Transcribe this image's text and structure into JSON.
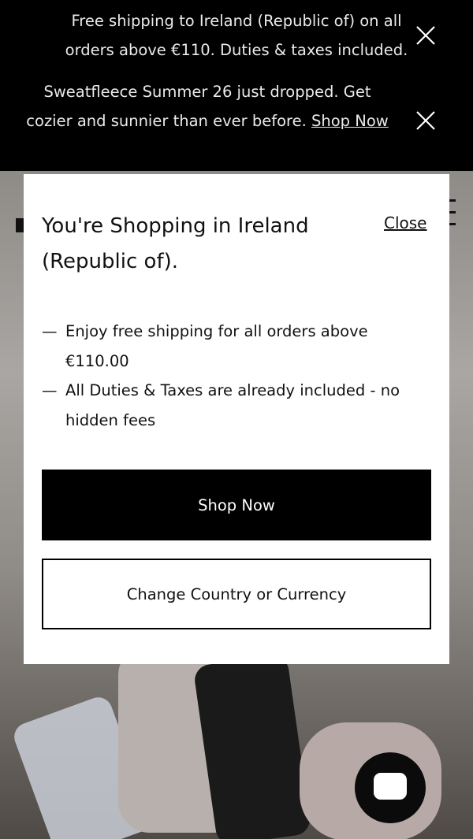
{
  "announcements": [
    {
      "text": "Free shipping to Ireland (Republic of) on all orders above €110. Duties & taxes included.",
      "link": ""
    },
    {
      "text": "Sweatfleece Summer 26 just dropped. Get cozier and sunnier than ever before. ",
      "link": "Shop Now"
    }
  ],
  "modal": {
    "title": "You're Shopping in Ireland (Republic of).",
    "close_label": "Close",
    "benefit_dash": "—",
    "benefits": [
      "Enjoy free shipping for all orders above €110.00",
      "All Duties & Taxes are already included - no hidden fees"
    ],
    "primary_button": "Shop Now",
    "secondary_button": "Change Country or Currency"
  },
  "icons": {
    "announcement_close": "close-icon",
    "chat": "chat-icon",
    "menu": "menu-icon"
  },
  "colors": {
    "announcement_bg": "#000000",
    "modal_bg": "#ffffff",
    "primary_button_bg": "#000000"
  }
}
